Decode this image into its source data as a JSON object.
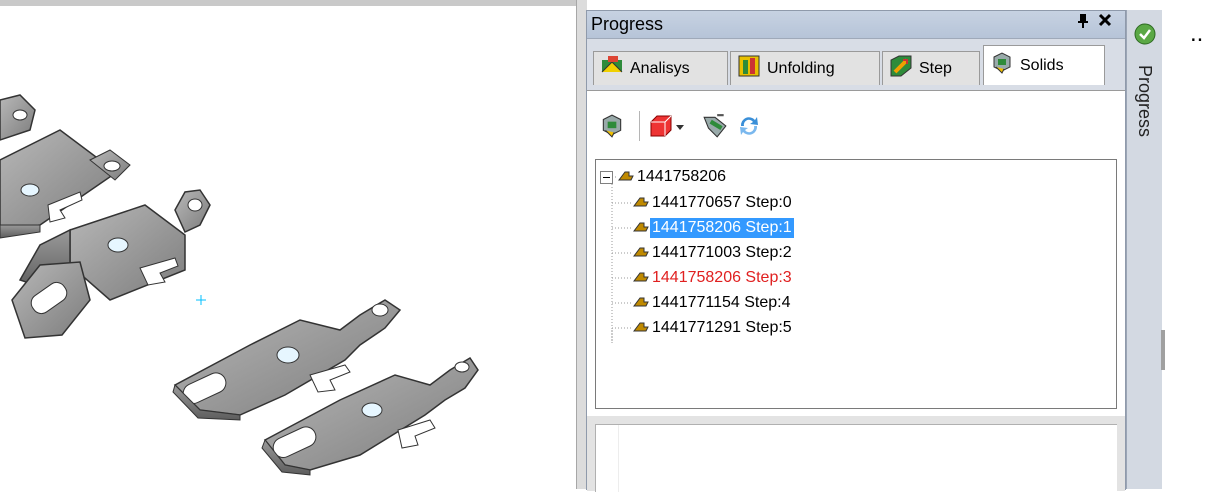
{
  "panel": {
    "title": "Progress",
    "pin_label": "↕",
    "close_label": "✕"
  },
  "tabs": [
    {
      "label": "Analisys",
      "icon": "analysis-icon"
    },
    {
      "label": "Unfolding",
      "icon": "unfolding-icon"
    },
    {
      "label": "Step",
      "icon": "step-icon"
    },
    {
      "label": "Solids",
      "icon": "solids-icon",
      "active": true
    }
  ],
  "toolbar": {
    "tools": [
      "solid-icon",
      "box-dropdown-icon",
      "solid-arrow-icon",
      "refresh-icon"
    ]
  },
  "tree": {
    "root": "1441758206",
    "children": [
      {
        "label": "1441770657 Step:0"
      },
      {
        "label": "1441758206 Step:1",
        "state": "selected"
      },
      {
        "label": "1441771003 Step:2"
      },
      {
        "label": "1441758206 Step:3",
        "state": "highlight"
      },
      {
        "label": "1441771154 Step:4"
      },
      {
        "label": "1441771291 Step:5"
      }
    ]
  },
  "sidebar": {
    "label": "Progress"
  },
  "misc": {
    "ellipsis": ".."
  },
  "colors": {
    "selection": "#3399ff",
    "highlight_text": "#e02020",
    "panel_bg": "#d8dde6"
  }
}
